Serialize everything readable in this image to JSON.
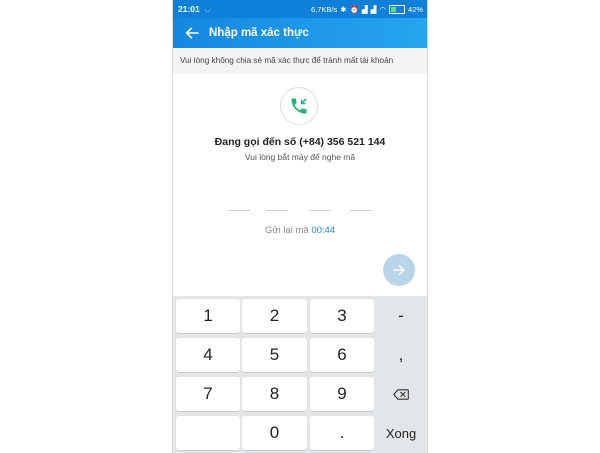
{
  "status_bar": {
    "time": "21:01",
    "network_speed": "6,7KB/s",
    "battery_level": "42%"
  },
  "app_bar": {
    "title": "Nhập mã xác thực"
  },
  "notice": "Vui lòng không chia sẻ mã xác thực để tránh mất tài khoản",
  "calling": {
    "title": "Đang gọi đến số (+84) 356 521 144",
    "subtitle": "Vui lòng bắt máy để nghe mã"
  },
  "resend": {
    "label": "Gửi lại mã",
    "timer": "00:44"
  },
  "keypad": {
    "rows": [
      [
        "1",
        "2",
        "3",
        "-"
      ],
      [
        "4",
        "5",
        "6",
        ","
      ],
      [
        "7",
        "8",
        "9",
        "⌫"
      ],
      [
        "",
        "0",
        ".",
        "Xong"
      ]
    ]
  },
  "colors": {
    "primary": "#1388e0",
    "accent_green": "#21b573",
    "timer_blue": "#1c8fdb",
    "next_disabled": "#b9d5ea"
  }
}
